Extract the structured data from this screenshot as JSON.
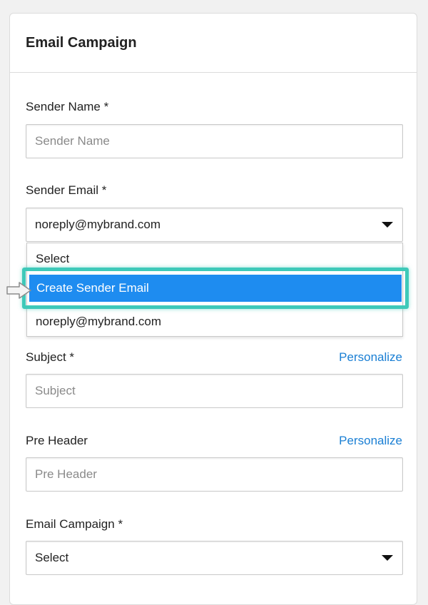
{
  "card": {
    "title": "Email Campaign"
  },
  "sender_name": {
    "label": "Sender Name *",
    "placeholder": "Sender Name"
  },
  "sender_email": {
    "label": "Sender Email *",
    "selected": "noreply@mybrand.com",
    "options": [
      "Select",
      "Create Sender Email",
      "noreply@mybrand.com"
    ],
    "highlighted_option": "Create Sender Email"
  },
  "subject": {
    "label": "Subject *",
    "placeholder": "Subject",
    "personalize": "Personalize"
  },
  "pre_header": {
    "label": "Pre Header",
    "placeholder": "Pre Header",
    "personalize": "Personalize"
  },
  "email_campaign": {
    "label": "Email Campaign *",
    "selected": "Select"
  },
  "colors": {
    "accent": "#1e8cf0",
    "link": "#1a7fd4",
    "highlight_frame": "#3ec9b9"
  },
  "icons": [
    "chevron-down-icon",
    "pointer-arrow-icon"
  ]
}
